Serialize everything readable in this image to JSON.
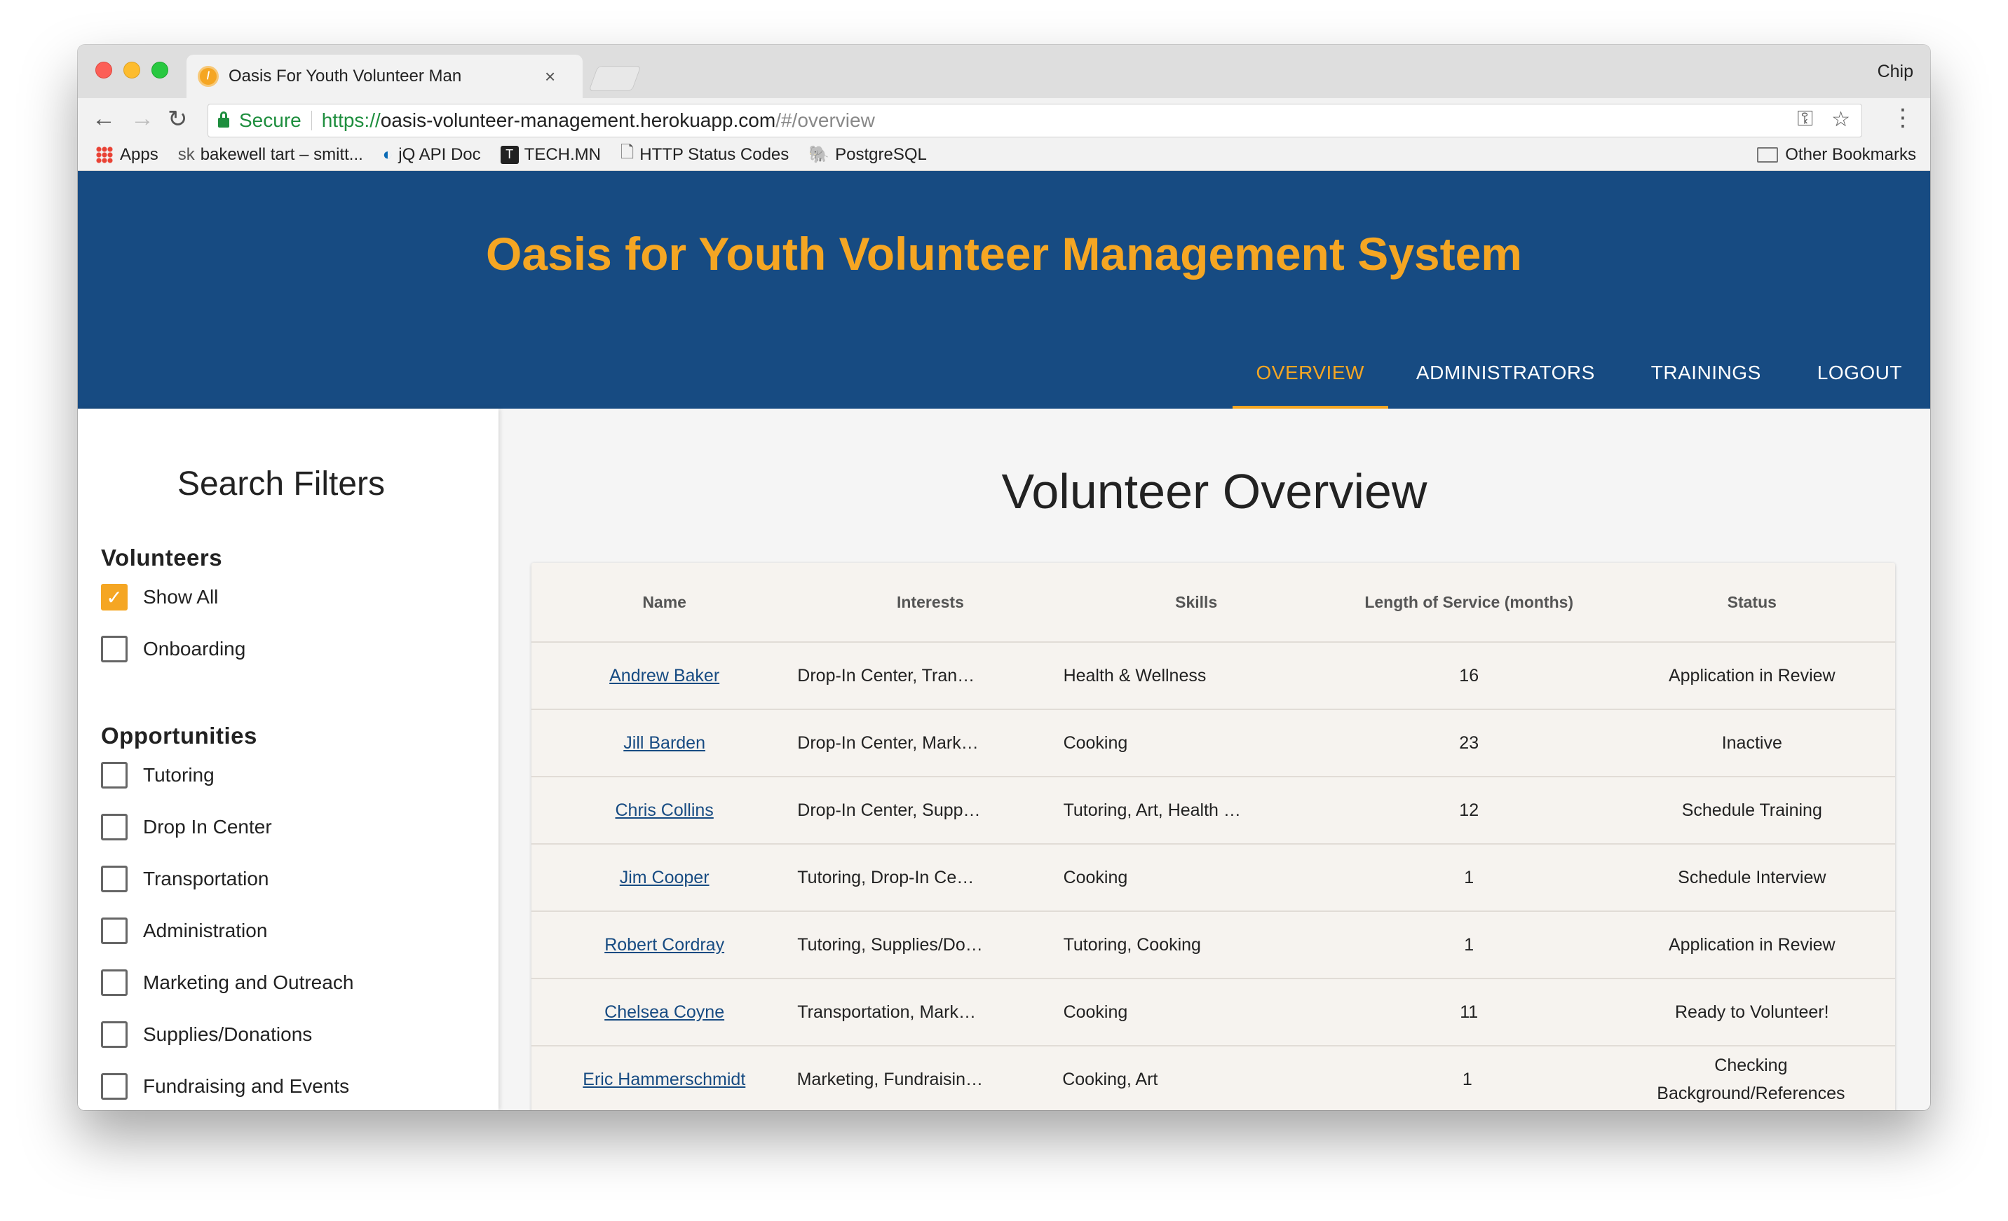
{
  "browser": {
    "tab_title": "Oasis For Youth Volunteer Man",
    "profile": "Chip",
    "secure_label": "Secure",
    "url_scheme": "https://",
    "url_host": "oasis-volunteer-management.herokuapp.com",
    "url_path": "/#/overview",
    "bookmarks": [
      "Apps",
      "bakewell tart – smitt...",
      "jQ API Doc",
      "TECH.MN",
      "HTTP Status Codes",
      "PostgreSQL"
    ],
    "other_bookmarks": "Other Bookmarks"
  },
  "header": {
    "title": "Oasis for Youth Volunteer Management System",
    "nav": [
      "OVERVIEW",
      "ADMINISTRATORS",
      "TRAININGS",
      "LOGOUT"
    ]
  },
  "sidebar": {
    "title": "Search Filters",
    "volunteers_heading": "Volunteers",
    "volunteers": [
      {
        "label": "Show All",
        "checked": true
      },
      {
        "label": "Onboarding",
        "checked": false
      }
    ],
    "opportunities_heading": "Opportunities",
    "opportunities": [
      {
        "label": "Tutoring",
        "checked": false
      },
      {
        "label": "Drop In Center",
        "checked": false
      },
      {
        "label": "Transportation",
        "checked": false
      },
      {
        "label": "Administration",
        "checked": false
      },
      {
        "label": "Marketing and Outreach",
        "checked": false
      },
      {
        "label": "Supplies/Donations",
        "checked": false
      },
      {
        "label": "Fundraising and Events",
        "checked": false
      }
    ]
  },
  "main": {
    "title": "Volunteer Overview",
    "columns": [
      "Name",
      "Interests",
      "Skills",
      "Length of Service (months)",
      "Status"
    ],
    "rows": [
      {
        "name": "Andrew Baker",
        "interests": "Drop-In Center, Tran…",
        "skills": "Health & Wellness",
        "length": "16",
        "status": "Application in Review"
      },
      {
        "name": "Jill Barden",
        "interests": "Drop-In Center, Mark…",
        "skills": "Cooking",
        "length": "23",
        "status": "Inactive"
      },
      {
        "name": "Chris Collins",
        "interests": "Drop-In Center, Supp…",
        "skills": "Tutoring, Art, Health …",
        "length": "12",
        "status": "Schedule Training"
      },
      {
        "name": "Jim Cooper",
        "interests": "Tutoring, Drop-In Ce…",
        "skills": "Cooking",
        "length": "1",
        "status": "Schedule Interview"
      },
      {
        "name": "Robert Cordray",
        "interests": "Tutoring, Supplies/Do…",
        "skills": "Tutoring, Cooking",
        "length": "1",
        "status": "Application in Review"
      },
      {
        "name": "Chelsea Coyne",
        "interests": "Transportation, Mark…",
        "skills": "Cooking",
        "length": "11",
        "status": "Ready to Volunteer!"
      },
      {
        "name": "Eric Hammerschmidt",
        "interests": "Marketing, Fundraisin…",
        "skills": "Cooking, Art",
        "length": "1",
        "status": "Checking Background/References"
      }
    ]
  }
}
